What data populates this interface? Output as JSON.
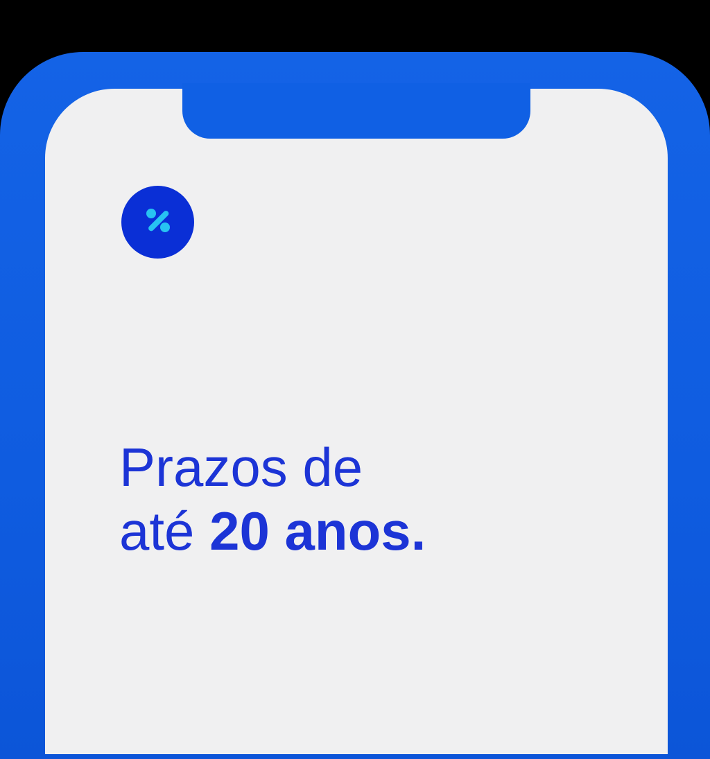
{
  "screen": {
    "icon": "percent-icon",
    "headline": {
      "line1": "Prazos de",
      "line2_prefix": "até ",
      "line2_emphasis": "20 anos."
    }
  },
  "colors": {
    "frame": "#1463e6",
    "screen": "#f0f0f1",
    "badge": "#0a2fd6",
    "icon": "#27c3f2",
    "text": "#1c34d6"
  }
}
